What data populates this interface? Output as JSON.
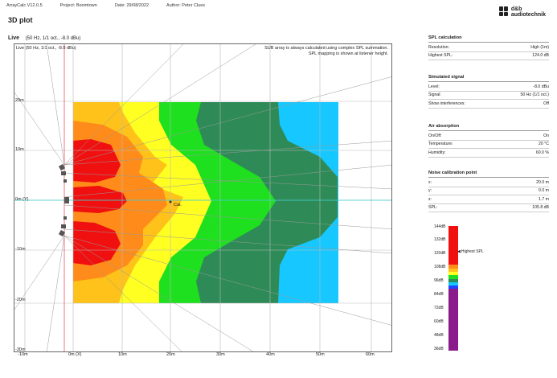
{
  "header": {
    "app": "ArrayCalc V12.0.5",
    "project": "Project: Boomtown",
    "date": "Date: 29/08/2022",
    "author": "Author: Peter Clues",
    "logo_line1": "d&b",
    "logo_line2": "audiotechnik"
  },
  "page_title": "3D plot",
  "plot": {
    "name": "Live",
    "params": "(50 Hz, 1/1 oct., -8.0 dBu)",
    "inner_label": "Live     (50 Hz, 1/1 oct., -8.0 dBu)",
    "note_line1": "SUB array is always calculated using complex SPL summation.",
    "note_line2": "SPL mapping is shown at listener height.",
    "cat_label": "Cat.",
    "y_labels": [
      "20m",
      "10m",
      "0m (Y)",
      "-10m",
      "-20m",
      "-30m"
    ],
    "x_labels": [
      "-10m",
      "0m (X)",
      "10m",
      "20m",
      "30m",
      "40m",
      "50m",
      "60m"
    ],
    "colors": {
      "red": "#f01010",
      "orange": "#ff8c1a",
      "amber": "#ffc21a",
      "yellow": "#ffff22",
      "green": "#1ee01e",
      "darkgreen": "#2e8b57",
      "cyan": "#16c8ff"
    }
  },
  "sidebar": {
    "spl": {
      "title": "SPL calculation",
      "rows": [
        {
          "label": "Resolution:",
          "value": "High (1m)"
        },
        {
          "label": "Highest SPL:",
          "value": "124.0 dB"
        }
      ]
    },
    "signal": {
      "title": "Simulated signal",
      "rows": [
        {
          "label": "Level:",
          "value": "-8.0 dBu"
        },
        {
          "label": "Signal:",
          "value": "50 Hz (1/1 oct.)"
        },
        {
          "label": "Show interferences:",
          "value": "Off"
        }
      ]
    },
    "air": {
      "title": "Air absorption",
      "rows": [
        {
          "label": "On/Off:",
          "value": "On"
        },
        {
          "label": "Temperature:",
          "value": "20 °C"
        },
        {
          "label": "Humidity:",
          "value": "60.0 %"
        }
      ]
    },
    "noise": {
      "title": "Noise calibration point",
      "rows": [
        {
          "label": "x:",
          "value": "20.0 m"
        },
        {
          "label": "y:",
          "value": "0.0 m"
        },
        {
          "label": "z:",
          "value": "1.7 m"
        },
        {
          "label": "SPL:",
          "value": "105.8 dB"
        }
      ]
    }
  },
  "scale": {
    "labels": [
      "144dB",
      "132dB",
      "120dB",
      "108dB",
      "96dB",
      "84dB",
      "72dB",
      "60dB",
      "48dB",
      "36dB"
    ],
    "highest_label": "Highest SPL"
  }
}
